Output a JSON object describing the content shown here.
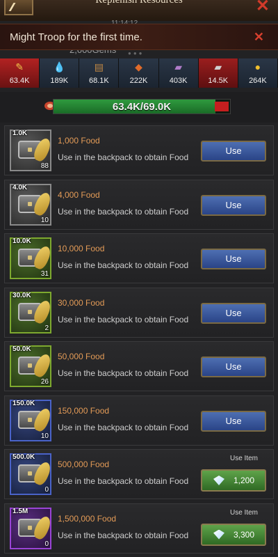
{
  "header": {
    "title": "Replenish Resources",
    "gems": "2,000Gems",
    "timer": "11:14:12"
  },
  "notification": {
    "text": "Might Troop for the first time."
  },
  "resources": [
    {
      "name": "food",
      "value": "63.4K",
      "icon": "food-icon"
    },
    {
      "name": "water",
      "value": "189K",
      "icon": "water-icon"
    },
    {
      "name": "wood",
      "value": "68.1K",
      "icon": "wood-icon"
    },
    {
      "name": "ore",
      "value": "222K",
      "icon": "ore-icon"
    },
    {
      "name": "metal",
      "value": "403K",
      "icon": "metal-icon"
    },
    {
      "name": "iron",
      "value": "14.5K",
      "icon": "iron-icon"
    },
    {
      "name": "gold",
      "value": "264K",
      "icon": "gold-icon"
    }
  ],
  "progress": {
    "text": "63.4K/69.0K",
    "fraction": 0.919
  },
  "items": [
    {
      "top_label": "1.0K",
      "count": "88",
      "name": "1,000 Food",
      "desc": "Use in the backpack to obtain Food",
      "button": "Use",
      "tier": "gray"
    },
    {
      "top_label": "4.0K",
      "count": "10",
      "name": "4,000 Food",
      "desc": "Use in the backpack to obtain Food",
      "button": "Use",
      "tier": "gray"
    },
    {
      "top_label": "10.0K",
      "count": "31",
      "name": "10,000 Food",
      "desc": "Use in the backpack to obtain Food",
      "button": "Use",
      "tier": "green"
    },
    {
      "top_label": "30.0K",
      "count": "2",
      "name": "30,000 Food",
      "desc": "Use in the backpack to obtain Food",
      "button": "Use",
      "tier": "green"
    },
    {
      "top_label": "50.0K",
      "count": "26",
      "name": "50,000 Food",
      "desc": "Use in the backpack to obtain Food",
      "button": "Use",
      "tier": "green"
    },
    {
      "top_label": "150.0K",
      "count": "10",
      "name": "150,000 Food",
      "desc": "Use in the backpack to obtain Food",
      "button": "Use",
      "tier": "blue"
    },
    {
      "top_label": "500.0K",
      "count": "0",
      "name": "500,000 Food",
      "desc": "Use in the backpack to obtain Food",
      "use_item_label": "Use Item",
      "gem_cost": "1,200",
      "tier": "blue"
    },
    {
      "top_label": "1.5M",
      "count": "0",
      "name": "1,500,000 Food",
      "desc": "Use in the backpack to obtain Food",
      "use_item_label": "Use Item",
      "gem_cost": "3,300",
      "tier": "purple"
    }
  ]
}
